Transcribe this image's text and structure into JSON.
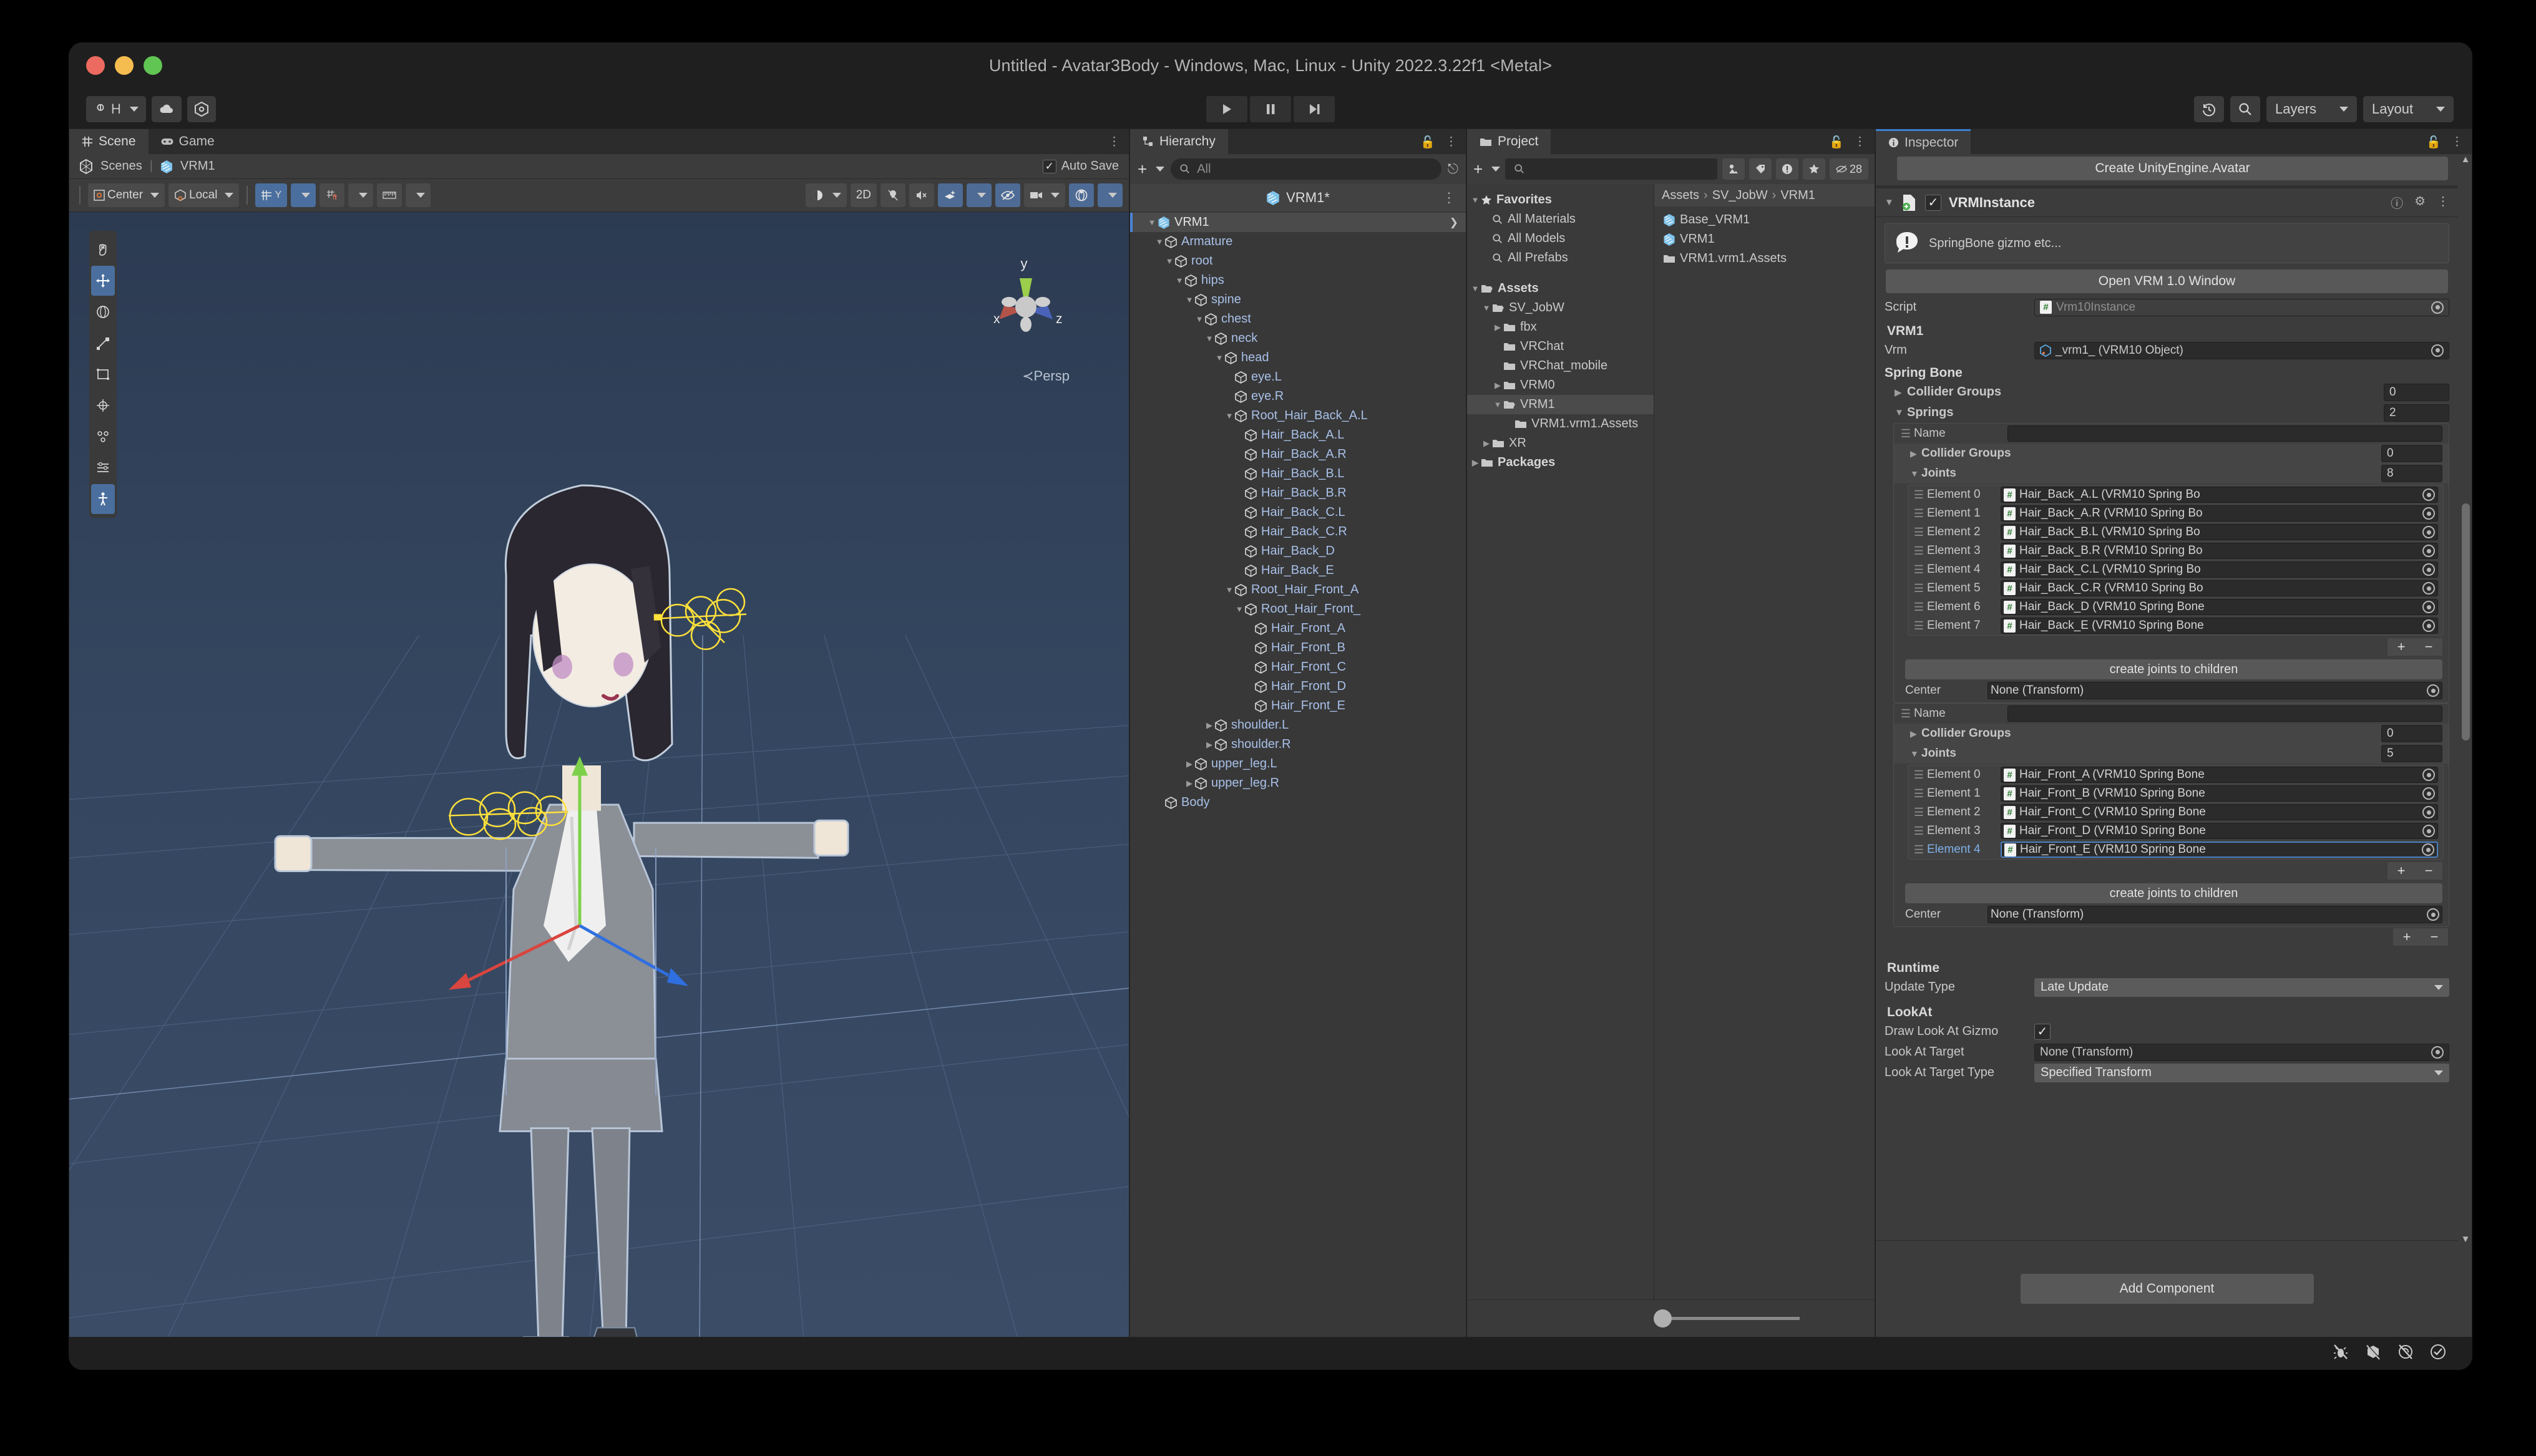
{
  "window": {
    "title": "Untitled - Avatar3Body - Windows, Mac, Linux - Unity 2022.3.22f1 <Metal>"
  },
  "toolbar": {
    "account_label": "H",
    "cloud_icon": "cloud-icon",
    "settings_icon": "gear-icon",
    "play_icon": "play-icon",
    "pause_icon": "pause-icon",
    "step_icon": "step-icon",
    "history_icon": "history-icon",
    "search_icon": "search-icon",
    "layers_label": "Layers",
    "layout_label": "Layout"
  },
  "scene": {
    "tabs": [
      {
        "label": "Scene",
        "icon": "grid-icon",
        "active": true
      },
      {
        "label": "Game",
        "icon": "gamepad-icon",
        "active": false
      }
    ],
    "breadcrumb_scenes": "Scenes",
    "breadcrumb_current": "VRM1",
    "auto_save_label": "Auto Save",
    "auto_save_checked": "✓",
    "tools": {
      "pivot_label": "Center",
      "space_label": "Local",
      "grid_y_label": "Y",
      "mode_2d": "2D",
      "persp_label": "Persp"
    },
    "axis_x": "x",
    "axis_y": "y",
    "axis_z": "z",
    "left_tools": [
      "hand-tool-icon",
      "move-tool-icon",
      "rotate-tool-icon",
      "scale-tool-icon",
      "rect-tool-icon",
      "transform-tool-icon",
      "custom-tool-icon",
      "custom-editor-tool-icon",
      "avatar-tool-icon"
    ]
  },
  "hierarchy": {
    "tab_label": "Hierarchy",
    "add_label": "+",
    "search_placeholder": "All",
    "scene_root": "VRM1*",
    "nodes": [
      {
        "label": "VRM1",
        "depth": 1,
        "tri": "▼",
        "selected": true,
        "kind": "prefab"
      },
      {
        "label": "Armature",
        "depth": 2,
        "tri": "▼",
        "selected": false,
        "kind": "go"
      },
      {
        "label": "root",
        "depth": 3,
        "tri": "▼",
        "selected": false,
        "kind": "go"
      },
      {
        "label": "hips",
        "depth": 4,
        "tri": "▼",
        "selected": false,
        "kind": "go"
      },
      {
        "label": "spine",
        "depth": 5,
        "tri": "▼",
        "selected": false,
        "kind": "go"
      },
      {
        "label": "chest",
        "depth": 6,
        "tri": "▼",
        "selected": false,
        "kind": "go"
      },
      {
        "label": "neck",
        "depth": 7,
        "tri": "▼",
        "selected": false,
        "kind": "go"
      },
      {
        "label": "head",
        "depth": 8,
        "tri": "▼",
        "selected": false,
        "kind": "go"
      },
      {
        "label": "eye.L",
        "depth": 9,
        "tri": "",
        "selected": false,
        "kind": "go"
      },
      {
        "label": "eye.R",
        "depth": 9,
        "tri": "",
        "selected": false,
        "kind": "go"
      },
      {
        "label": "Root_Hair_Back_A.L",
        "depth": 9,
        "tri": "▼",
        "selected": false,
        "kind": "go"
      },
      {
        "label": "Hair_Back_A.L",
        "depth": 10,
        "tri": "",
        "selected": false,
        "kind": "go"
      },
      {
        "label": "Hair_Back_A.R",
        "depth": 10,
        "tri": "",
        "selected": false,
        "kind": "go"
      },
      {
        "label": "Hair_Back_B.L",
        "depth": 10,
        "tri": "",
        "selected": false,
        "kind": "go"
      },
      {
        "label": "Hair_Back_B.R",
        "depth": 10,
        "tri": "",
        "selected": false,
        "kind": "go"
      },
      {
        "label": "Hair_Back_C.L",
        "depth": 10,
        "tri": "",
        "selected": false,
        "kind": "go"
      },
      {
        "label": "Hair_Back_C.R",
        "depth": 10,
        "tri": "",
        "selected": false,
        "kind": "go"
      },
      {
        "label": "Hair_Back_D",
        "depth": 10,
        "tri": "",
        "selected": false,
        "kind": "go"
      },
      {
        "label": "Hair_Back_E",
        "depth": 10,
        "tri": "",
        "selected": false,
        "kind": "go"
      },
      {
        "label": "Root_Hair_Front_A",
        "depth": 9,
        "tri": "▼",
        "selected": false,
        "kind": "go"
      },
      {
        "label": "Root_Hair_Front_",
        "depth": 10,
        "tri": "▼",
        "selected": false,
        "kind": "go"
      },
      {
        "label": "Hair_Front_A",
        "depth": 11,
        "tri": "",
        "selected": false,
        "kind": "go"
      },
      {
        "label": "Hair_Front_B",
        "depth": 11,
        "tri": "",
        "selected": false,
        "kind": "go"
      },
      {
        "label": "Hair_Front_C",
        "depth": 11,
        "tri": "",
        "selected": false,
        "kind": "go"
      },
      {
        "label": "Hair_Front_D",
        "depth": 11,
        "tri": "",
        "selected": false,
        "kind": "go"
      },
      {
        "label": "Hair_Front_E",
        "depth": 11,
        "tri": "",
        "selected": false,
        "kind": "go"
      },
      {
        "label": "shoulder.L",
        "depth": 7,
        "tri": "▶",
        "selected": false,
        "kind": "go"
      },
      {
        "label": "shoulder.R",
        "depth": 7,
        "tri": "▶",
        "selected": false,
        "kind": "go"
      },
      {
        "label": "upper_leg.L",
        "depth": 5,
        "tri": "▶",
        "selected": false,
        "kind": "go"
      },
      {
        "label": "upper_leg.R",
        "depth": 5,
        "tri": "▶",
        "selected": false,
        "kind": "go"
      },
      {
        "label": "Body",
        "depth": 2,
        "tri": "",
        "selected": false,
        "kind": "go"
      }
    ]
  },
  "project": {
    "tab_label": "Project",
    "add_label": "+",
    "search_placeholder": "",
    "hidden_count": "28",
    "toolbar_icons": [
      "package-icon",
      "label-icon",
      "warning-icon",
      "star-icon",
      "hidden-eye-icon"
    ],
    "tree": [
      {
        "label": "Favorites",
        "depth": 0,
        "tri": "▼",
        "icon": "star-icon",
        "bold": true,
        "sel": false
      },
      {
        "label": "All Materials",
        "depth": 1,
        "tri": "",
        "icon": "search-icon",
        "bold": false,
        "sel": false
      },
      {
        "label": "All Models",
        "depth": 1,
        "tri": "",
        "icon": "search-icon",
        "bold": false,
        "sel": false
      },
      {
        "label": "All Prefabs",
        "depth": 1,
        "tri": "",
        "icon": "search-icon",
        "bold": false,
        "sel": false
      },
      {
        "label": "",
        "depth": 0,
        "tri": "",
        "icon": "spacer",
        "bold": false,
        "sel": false
      },
      {
        "label": "Assets",
        "depth": 0,
        "tri": "▼",
        "icon": "folder-open-icon",
        "bold": true,
        "sel": false
      },
      {
        "label": "SV_JobW",
        "depth": 1,
        "tri": "▼",
        "icon": "folder-open-icon",
        "bold": false,
        "sel": false
      },
      {
        "label": "fbx",
        "depth": 2,
        "tri": "▶",
        "icon": "folder-icon",
        "bold": false,
        "sel": false
      },
      {
        "label": "VRChat",
        "depth": 2,
        "tri": "",
        "icon": "folder-icon",
        "bold": false,
        "sel": false
      },
      {
        "label": "VRChat_mobile",
        "depth": 2,
        "tri": "",
        "icon": "folder-icon",
        "bold": false,
        "sel": false
      },
      {
        "label": "VRM0",
        "depth": 2,
        "tri": "▶",
        "icon": "folder-icon",
        "bold": false,
        "sel": false
      },
      {
        "label": "VRM1",
        "depth": 2,
        "tri": "▼",
        "icon": "folder-open-icon",
        "bold": false,
        "sel": true
      },
      {
        "label": "VRM1.vrm1.Assets",
        "depth": 3,
        "tri": "",
        "icon": "folder-icon",
        "bold": false,
        "sel": false
      },
      {
        "label": "XR",
        "depth": 1,
        "tri": "▶",
        "icon": "folder-icon",
        "bold": false,
        "sel": false
      },
      {
        "label": "Packages",
        "depth": 0,
        "tri": "▶",
        "icon": "folder-icon",
        "bold": true,
        "sel": false
      }
    ],
    "breadcrumb": [
      "Assets",
      "SV_JobW",
      "VRM1"
    ],
    "items": [
      {
        "label": "Base_VRM1",
        "icon": "prefab-icon"
      },
      {
        "label": "VRM1",
        "icon": "prefab-icon"
      },
      {
        "label": "VRM1.vrm1.Assets",
        "icon": "folder-icon"
      }
    ]
  },
  "inspector": {
    "tab_label": "Inspector",
    "create_avatar_button": "Create UnityEngine.Avatar",
    "component_name": "VRMInstance",
    "component_enabled": "✓",
    "helpbox_text": "SpringBone gizmo etc...",
    "open_window_button": "Open VRM 1.0 Window",
    "script_label": "Script",
    "script_value": "Vrm10Instance",
    "vrm_section_title": "VRM1",
    "vrm_label": "Vrm",
    "vrm_value": "_vrm1_ (VRM10 Object)",
    "spring_bone_title": "Spring Bone",
    "collider_groups_label": "Collider Groups",
    "collider_groups_count": "0",
    "springs_label": "Springs",
    "springs_count": "2",
    "name_label": "Name",
    "name_value": "",
    "joints_label": "Joints",
    "create_joints_button": "create joints to children",
    "center_label": "Center",
    "center_value": "None (Transform)",
    "springs": [
      {
        "name": "",
        "collider_groups_label": "Collider Groups",
        "collider_groups_count": "0",
        "joints_label": "Joints",
        "joints_count": "8",
        "elements": [
          {
            "index": "Element 0",
            "value": "Hair_Back_A.L (VRM10 Spring Bo",
            "highlight": false
          },
          {
            "index": "Element 1",
            "value": "Hair_Back_A.R (VRM10 Spring Bo",
            "highlight": false
          },
          {
            "index": "Element 2",
            "value": "Hair_Back_B.L (VRM10 Spring Bo",
            "highlight": false
          },
          {
            "index": "Element 3",
            "value": "Hair_Back_B.R (VRM10 Spring Bo",
            "highlight": false
          },
          {
            "index": "Element 4",
            "value": "Hair_Back_C.L (VRM10 Spring Bo",
            "highlight": false
          },
          {
            "index": "Element 5",
            "value": "Hair_Back_C.R (VRM10 Spring Bo",
            "highlight": false
          },
          {
            "index": "Element 6",
            "value": "Hair_Back_D (VRM10 Spring Bone",
            "highlight": false
          },
          {
            "index": "Element 7",
            "value": "Hair_Back_E (VRM10 Spring Bone",
            "highlight": false
          }
        ]
      },
      {
        "name": "",
        "collider_groups_label": "Collider Groups",
        "collider_groups_count": "0",
        "joints_label": "Joints",
        "joints_count": "5",
        "elements": [
          {
            "index": "Element 0",
            "value": "Hair_Front_A (VRM10 Spring Bone",
            "highlight": false
          },
          {
            "index": "Element 1",
            "value": "Hair_Front_B (VRM10 Spring Bone",
            "highlight": false
          },
          {
            "index": "Element 2",
            "value": "Hair_Front_C (VRM10 Spring Bone",
            "highlight": false
          },
          {
            "index": "Element 3",
            "value": "Hair_Front_D (VRM10 Spring Bone",
            "highlight": false
          },
          {
            "index": "Element 4",
            "value": "Hair_Front_E (VRM10 Spring Bone",
            "highlight": true
          }
        ]
      }
    ],
    "runtime_title": "Runtime",
    "update_type_label": "Update Type",
    "update_type_value": "Late Update",
    "lookat_title": "LookAt",
    "draw_gizmo_label": "Draw Look At Gizmo",
    "draw_gizmo_checked": "✓",
    "look_at_target_label": "Look At Target",
    "look_at_target_value": "None (Transform)",
    "look_at_target_type_label": "Look At Target Type",
    "look_at_target_type_value": "Specified Transform",
    "add_component_button": "Add Component"
  },
  "statusbar": {
    "icons": [
      "bug-off-icon",
      "collab-off-icon",
      "preview-off-icon",
      "check-circle-icon"
    ]
  },
  "colors": {
    "accent_blue": "#3b7fd4",
    "viewport_bg": "#31435c",
    "panel_bg": "#3c3c3c",
    "toolbar_bg": "#1f1f1f",
    "gizmo_y": "#9ace4b",
    "gizmo_x": "#b4534a",
    "gizmo_z": "#4a63b8",
    "springbone_gizmo": "#ffe13a"
  }
}
